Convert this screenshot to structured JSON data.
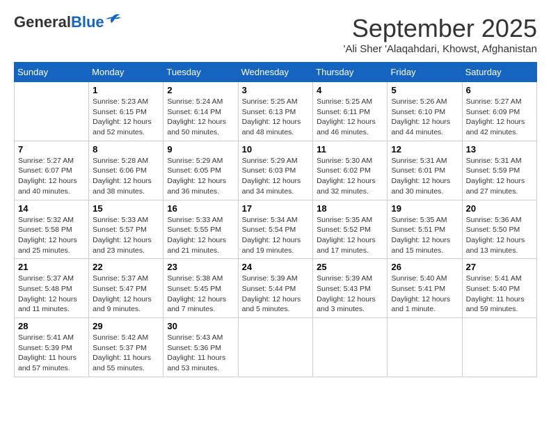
{
  "header": {
    "logo_line1": "General",
    "logo_line2": "Blue",
    "month": "September 2025",
    "location": "'Ali Sher 'Alaqahdari, Khowst, Afghanistan"
  },
  "days_of_week": [
    "Sunday",
    "Monday",
    "Tuesday",
    "Wednesday",
    "Thursday",
    "Friday",
    "Saturday"
  ],
  "weeks": [
    [
      {
        "day": "",
        "info": ""
      },
      {
        "day": "1",
        "info": "Sunrise: 5:23 AM\nSunset: 6:15 PM\nDaylight: 12 hours\nand 52 minutes."
      },
      {
        "day": "2",
        "info": "Sunrise: 5:24 AM\nSunset: 6:14 PM\nDaylight: 12 hours\nand 50 minutes."
      },
      {
        "day": "3",
        "info": "Sunrise: 5:25 AM\nSunset: 6:13 PM\nDaylight: 12 hours\nand 48 minutes."
      },
      {
        "day": "4",
        "info": "Sunrise: 5:25 AM\nSunset: 6:11 PM\nDaylight: 12 hours\nand 46 minutes."
      },
      {
        "day": "5",
        "info": "Sunrise: 5:26 AM\nSunset: 6:10 PM\nDaylight: 12 hours\nand 44 minutes."
      },
      {
        "day": "6",
        "info": "Sunrise: 5:27 AM\nSunset: 6:09 PM\nDaylight: 12 hours\nand 42 minutes."
      }
    ],
    [
      {
        "day": "7",
        "info": "Sunrise: 5:27 AM\nSunset: 6:07 PM\nDaylight: 12 hours\nand 40 minutes."
      },
      {
        "day": "8",
        "info": "Sunrise: 5:28 AM\nSunset: 6:06 PM\nDaylight: 12 hours\nand 38 minutes."
      },
      {
        "day": "9",
        "info": "Sunrise: 5:29 AM\nSunset: 6:05 PM\nDaylight: 12 hours\nand 36 minutes."
      },
      {
        "day": "10",
        "info": "Sunrise: 5:29 AM\nSunset: 6:03 PM\nDaylight: 12 hours\nand 34 minutes."
      },
      {
        "day": "11",
        "info": "Sunrise: 5:30 AM\nSunset: 6:02 PM\nDaylight: 12 hours\nand 32 minutes."
      },
      {
        "day": "12",
        "info": "Sunrise: 5:31 AM\nSunset: 6:01 PM\nDaylight: 12 hours\nand 30 minutes."
      },
      {
        "day": "13",
        "info": "Sunrise: 5:31 AM\nSunset: 5:59 PM\nDaylight: 12 hours\nand 27 minutes."
      }
    ],
    [
      {
        "day": "14",
        "info": "Sunrise: 5:32 AM\nSunset: 5:58 PM\nDaylight: 12 hours\nand 25 minutes."
      },
      {
        "day": "15",
        "info": "Sunrise: 5:33 AM\nSunset: 5:57 PM\nDaylight: 12 hours\nand 23 minutes."
      },
      {
        "day": "16",
        "info": "Sunrise: 5:33 AM\nSunset: 5:55 PM\nDaylight: 12 hours\nand 21 minutes."
      },
      {
        "day": "17",
        "info": "Sunrise: 5:34 AM\nSunset: 5:54 PM\nDaylight: 12 hours\nand 19 minutes."
      },
      {
        "day": "18",
        "info": "Sunrise: 5:35 AM\nSunset: 5:52 PM\nDaylight: 12 hours\nand 17 minutes."
      },
      {
        "day": "19",
        "info": "Sunrise: 5:35 AM\nSunset: 5:51 PM\nDaylight: 12 hours\nand 15 minutes."
      },
      {
        "day": "20",
        "info": "Sunrise: 5:36 AM\nSunset: 5:50 PM\nDaylight: 12 hours\nand 13 minutes."
      }
    ],
    [
      {
        "day": "21",
        "info": "Sunrise: 5:37 AM\nSunset: 5:48 PM\nDaylight: 12 hours\nand 11 minutes."
      },
      {
        "day": "22",
        "info": "Sunrise: 5:37 AM\nSunset: 5:47 PM\nDaylight: 12 hours\nand 9 minutes."
      },
      {
        "day": "23",
        "info": "Sunrise: 5:38 AM\nSunset: 5:45 PM\nDaylight: 12 hours\nand 7 minutes."
      },
      {
        "day": "24",
        "info": "Sunrise: 5:39 AM\nSunset: 5:44 PM\nDaylight: 12 hours\nand 5 minutes."
      },
      {
        "day": "25",
        "info": "Sunrise: 5:39 AM\nSunset: 5:43 PM\nDaylight: 12 hours\nand 3 minutes."
      },
      {
        "day": "26",
        "info": "Sunrise: 5:40 AM\nSunset: 5:41 PM\nDaylight: 12 hours\nand 1 minute."
      },
      {
        "day": "27",
        "info": "Sunrise: 5:41 AM\nSunset: 5:40 PM\nDaylight: 11 hours\nand 59 minutes."
      }
    ],
    [
      {
        "day": "28",
        "info": "Sunrise: 5:41 AM\nSunset: 5:39 PM\nDaylight: 11 hours\nand 57 minutes."
      },
      {
        "day": "29",
        "info": "Sunrise: 5:42 AM\nSunset: 5:37 PM\nDaylight: 11 hours\nand 55 minutes."
      },
      {
        "day": "30",
        "info": "Sunrise: 5:43 AM\nSunset: 5:36 PM\nDaylight: 11 hours\nand 53 minutes."
      },
      {
        "day": "",
        "info": ""
      },
      {
        "day": "",
        "info": ""
      },
      {
        "day": "",
        "info": ""
      },
      {
        "day": "",
        "info": ""
      }
    ]
  ]
}
